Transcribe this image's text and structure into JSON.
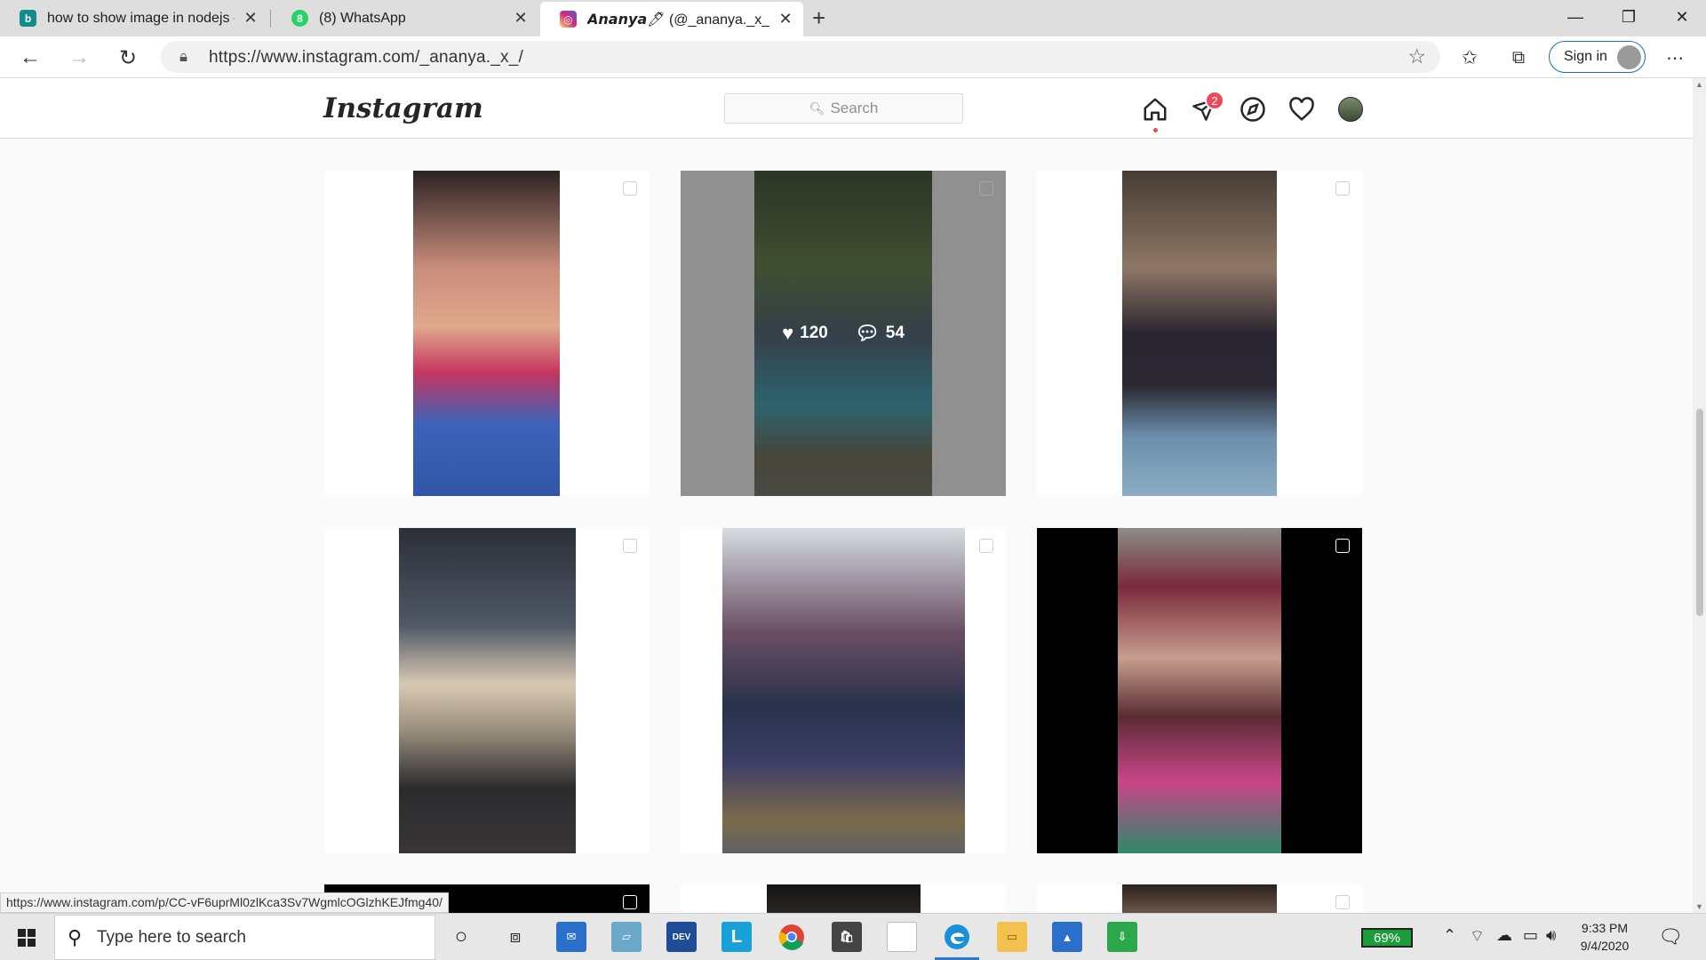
{
  "browser": {
    "tabs": [
      {
        "title": "how to show image in nodejs - B",
        "favicon": "bing-icon",
        "color": "#138b8b"
      },
      {
        "title": "(8) WhatsApp",
        "favicon": "whatsapp-icon",
        "color": "#25d366"
      },
      {
        "title": "𝘼𝙣𝙖𝙣𝙮𝙖🖊 (@_ananya._x_) • In",
        "favicon": "instagram-icon",
        "color": "#d6249f"
      }
    ],
    "url": "https://www.instagram.com/_ananya._x_/",
    "signin_label": "Sign in",
    "status_url": "https://www.instagram.com/p/CC-vF6uprMl0zlKca3Sv7WgmlcOGlzhKEJfmg40/"
  },
  "instagram": {
    "logo": "Instagram",
    "search_placeholder": "Search",
    "dm_badge": "2",
    "hover_post": {
      "likes": "120",
      "comments": "54"
    }
  },
  "taskbar": {
    "search_placeholder": "Type here to search",
    "battery": "69%",
    "time": "9:33 PM",
    "date": "9/4/2020",
    "apps": [
      "cortana-icon",
      "task-view-icon",
      "mail-icon",
      "app-icon",
      "devcpp-icon",
      "lync-icon",
      "chrome-icon",
      "store-icon",
      "notepad-icon",
      "edge-icon",
      "file-explorer-icon",
      "photos-icon",
      "downloader-icon"
    ]
  }
}
